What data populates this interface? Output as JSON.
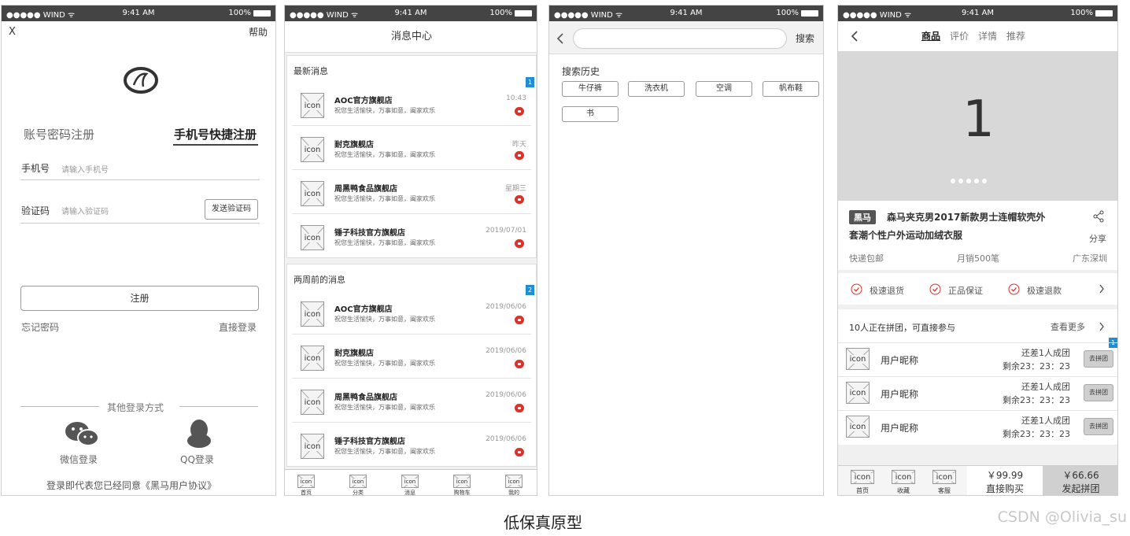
{
  "status_bar": {
    "carrier": "●●●●● WIND ᯤ",
    "time": "9:41 AM",
    "battery": "100%"
  },
  "login": {
    "close": "X",
    "help": "帮助",
    "tab_account": "账号密码注册",
    "tab_phone": "手机号快捷注册",
    "phone_label": "手机号",
    "phone_placeholder": "请输入手机号",
    "code_label": "验证码",
    "code_placeholder": "请输入验证码",
    "send_code": "发送验证码",
    "register": "注册",
    "forgot": "忘记密码",
    "direct_login": "直接登录",
    "other_methods": "其他登录方式",
    "wechat": "微信登录",
    "qq": "QQ登录",
    "agreement": "登录即代表您已经同意《黑马用户协议》"
  },
  "messages": {
    "title": "消息中心",
    "section_recent": "最新消息",
    "section_old": "两周前的消息",
    "badge_1": "1",
    "badge_2": "2",
    "icon_label": "icon",
    "recent": [
      {
        "name": "AOC官方旗舰店",
        "preview": "祝您生活愉快，万事如意，阖家欢乐",
        "time": "10:43"
      },
      {
        "name": "耐克旗舰店",
        "preview": "祝您生活愉快，万事如意，阖家欢乐",
        "time": "昨天"
      },
      {
        "name": "周黑鸭食品旗舰店",
        "preview": "祝您生活愉快，万事如意，阖家欢乐",
        "time": "星期三"
      },
      {
        "name": "锤子科技官方旗舰店",
        "preview": "祝您生活愉快，万事如意，阖家欢乐",
        "time": "2019/07/01"
      }
    ],
    "old": [
      {
        "name": "AOC官方旗舰店",
        "preview": "祝您生活愉快，万事如意，阖家欢乐",
        "time": "2019/06/06"
      },
      {
        "name": "耐克旗舰店",
        "preview": "祝您生活愉快，万事如意，阖家欢乐",
        "time": "2019/06/06"
      },
      {
        "name": "周黑鸭食品旗舰店",
        "preview": "祝您生活愉快，万事如意，阖家欢乐",
        "time": "2019/06/06"
      },
      {
        "name": "锤子科技官方旗舰店",
        "preview": "祝您生活愉快，万事如意，阖家欢乐",
        "time": "2019/06/06"
      }
    ],
    "tabbar": [
      "首页",
      "分类",
      "消息",
      "购物车",
      "我的"
    ]
  },
  "search": {
    "button": "搜索",
    "history_title": "搜索历史",
    "history": [
      "牛仔裤",
      "洗衣机",
      "空调",
      "帆布鞋",
      "书"
    ]
  },
  "product": {
    "tabs": [
      "商品",
      "评价",
      "详情",
      "推荐"
    ],
    "slide_number": "1",
    "brand_tag": "黑马",
    "title_line1": "森马夹克男2017新款男士连帽软壳外",
    "title_line2": "套潮个性户外运动加绒衣服",
    "share": "分享",
    "shipping": "快递包邮",
    "sales": "月销500笔",
    "location": "广东深圳",
    "guarantees": [
      "极速退货",
      "正品保证",
      "极速退款"
    ],
    "group_info": "10人正在拼团，可直接参与",
    "see_more": "查看更多",
    "badge": "1",
    "icon_label": "icon",
    "groups": [
      {
        "user": "用户昵称",
        "need": "还差1人成团",
        "remain": "剩余23：23：23",
        "join": "去拼团"
      },
      {
        "user": "用户昵称",
        "need": "还差1人成团",
        "remain": "剩余23：23：23",
        "join": "去拼团"
      },
      {
        "user": "用户昵称",
        "need": "还差1人成团",
        "remain": "剩余23：23：23",
        "join": "去拼团"
      }
    ],
    "bottom_tabs": [
      "首页",
      "收藏",
      "客服"
    ],
    "buy_price": "￥99.99",
    "buy_label": "直接购买",
    "group_price": "￥66.66",
    "group_label": "发起拼团"
  },
  "caption": "低保真原型",
  "watermark": "CSDN @Olivia_su"
}
